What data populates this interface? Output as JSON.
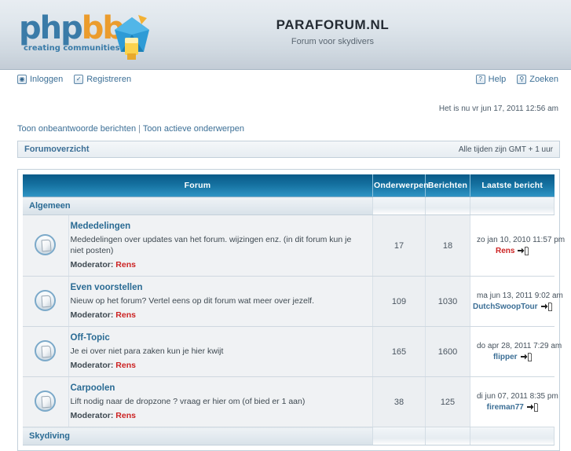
{
  "header": {
    "logo_php": "php",
    "logo_bb": "bb",
    "logo_tagline": "creating communities",
    "site_title": "PARAFORUM.NL",
    "site_description": "Forum voor skydivers"
  },
  "nav": {
    "left": [
      {
        "label": "Inloggen",
        "icon": "login-icon",
        "glyph": "◉"
      },
      {
        "label": "Registreren",
        "icon": "register-icon",
        "glyph": "✓"
      }
    ],
    "right": [
      {
        "label": "Help",
        "icon": "help-icon",
        "glyph": "?"
      },
      {
        "label": "Zoeken",
        "icon": "search-icon",
        "glyph": "⚲"
      }
    ]
  },
  "current_time": "Het is nu vr jun 17, 2011 12:56 am",
  "quick_links": {
    "unanswered": "Toon onbeantwoorde berichten",
    "separator": "|",
    "active": "Toon actieve onderwerpen"
  },
  "breadcrumb": {
    "index_label": "Forumoverzicht",
    "timezone": "Alle tijden zijn GMT + 1 uur"
  },
  "table": {
    "headers": {
      "forum": "Forum",
      "topics": "Onderwerpen",
      "posts": "Berichten",
      "last_post": "Laatste bericht"
    },
    "categories": [
      {
        "name": "Algemeen",
        "forums": [
          {
            "name": "Mededelingen",
            "description": "Mededelingen over updates van het forum. wijzingen enz. (in dit forum kun je niet posten)",
            "moderator_label": "Moderator:",
            "moderator": "Rens",
            "topics": "17",
            "posts": "18",
            "last_post_date": "zo jan 10, 2010 11:57 pm",
            "last_post_author": "Rens",
            "last_post_author_color": "red"
          },
          {
            "name": "Even voorstellen",
            "description": "Nieuw op het forum? Vertel eens op dit forum wat meer over jezelf.",
            "moderator_label": "Moderator:",
            "moderator": "Rens",
            "topics": "109",
            "posts": "1030",
            "last_post_date": "ma jun 13, 2011 9:02 am",
            "last_post_author": "DutchSwoopTour",
            "last_post_author_color": "blue"
          },
          {
            "name": "Off-Topic",
            "description": "Je ei over niet para zaken kun je hier kwijt",
            "moderator_label": "Moderator:",
            "moderator": "Rens",
            "topics": "165",
            "posts": "1600",
            "last_post_date": "do apr 28, 2011 7:29 am",
            "last_post_author": "flipper",
            "last_post_author_color": "blue"
          },
          {
            "name": "Carpoolen",
            "description": "Lift nodig naar de dropzone ? vraag er hier om (of bied er 1 aan)",
            "moderator_label": "Moderator:",
            "moderator": "Rens",
            "topics": "38",
            "posts": "125",
            "last_post_date": "di jun 07, 2011 8:35 pm",
            "last_post_author": "fireman77",
            "last_post_author_color": "blue"
          }
        ]
      },
      {
        "name": "Skydiving",
        "forums": []
      }
    ]
  },
  "colors": {
    "link_blue": "#3c6f96",
    "header_blue": "#14709f",
    "moderator_red": "#cc2222",
    "logo_orange": "#eb9c2d"
  }
}
